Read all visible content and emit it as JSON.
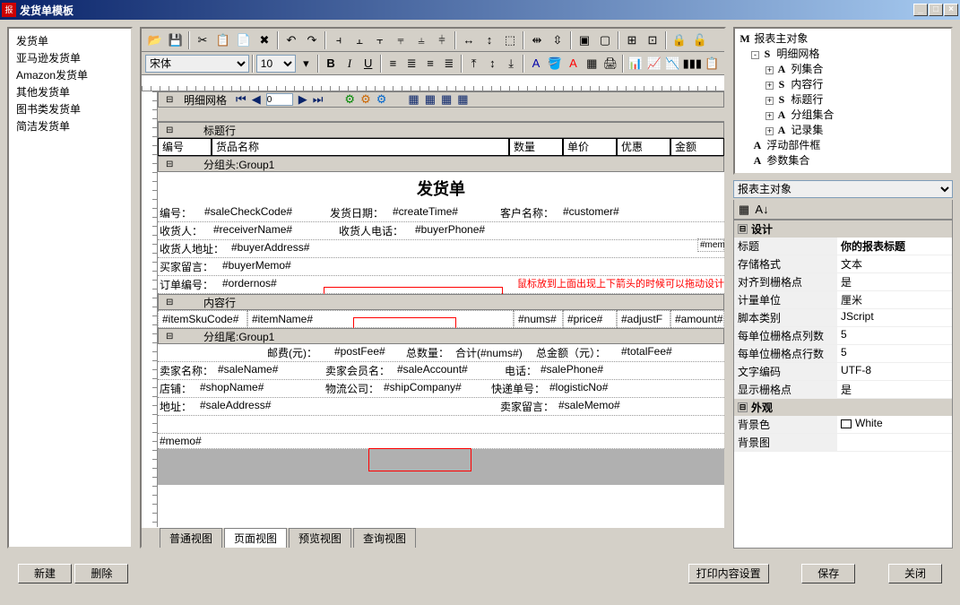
{
  "title": "发货单模板",
  "left_templates": [
    "发货单",
    "亚马逊发货单",
    "Amazon发货单",
    "其他发货单",
    "图书类发货单",
    "简洁发货单"
  ],
  "font": {
    "family": "宋体",
    "size": "10"
  },
  "grid_band": {
    "title": "明细网格",
    "page": "0"
  },
  "headers": {
    "c1": "编号",
    "c2": "货品名称",
    "c3": "数量",
    "c4": "单价",
    "c5": "优惠",
    "c6": "金额"
  },
  "bands": {
    "title_row": "标题行",
    "group_head": "分组头:Group1",
    "content_row": "内容行",
    "group_tail": "分组尾:Group1"
  },
  "report_title": "发货单",
  "fields": {
    "code_label": "编号：",
    "code_val": "#saleCheckCode#",
    "date_label": "发货日期：",
    "date_val": "#createTime#",
    "cust_label": "客户名称：",
    "cust_val": "#customer#",
    "recv_label": "收货人：",
    "recv_val": "#receiverName#",
    "phone_label": "收货人电话：",
    "phone_val": "#buyerPhone#",
    "addr_label": "收货人地址：",
    "addr_val": "#buyerAddress#",
    "memo_label": "买家留言：",
    "memo_val": "#buyerMemo#",
    "order_label": "订单编号：",
    "order_val": "#ordernos#",
    "side_memo": "#memo#oB",
    "sku": "#itemSkuCode#",
    "itemname": "#itemName#",
    "nums": "#nums#",
    "price": "#price#",
    "adjust": "#adjustF",
    "amount": "#amount#",
    "postfee_label": "邮费(元)：",
    "postfee": "#postFee#",
    "total_qty_label": "总数量：",
    "total_qty": "合计(#nums#)",
    "total_amt_label": "总金额（元）：",
    "total_amt": "#totalFee#",
    "seller_label": "卖家名称：",
    "seller": "#saleName#",
    "account_label": "卖家会员名：",
    "account": "#saleAccount#",
    "tel_label": "电话：",
    "tel": "#salePhone#",
    "shop_label": "店铺：",
    "shop": "#shopName#",
    "ship_label": "物流公司：",
    "ship": "#shipCompany#",
    "express_label": "快递单号：",
    "express": "#logisticNo#",
    "saddr_label": "地址：",
    "saddr": "#saleAddress#",
    "smemo_label": "卖家留言：",
    "smemo": "#saleMemo#",
    "bottom_memo": "#memo#"
  },
  "hint": "鼠标放到上面出现上下箭头的时候可以拖动设计",
  "tree": {
    "root": "报表主对象",
    "nodes": [
      "明细网格",
      "列集合",
      "内容行",
      "标题行",
      "分组集合",
      "记录集",
      "浮动部件框",
      "参数集合"
    ]
  },
  "prop_combo": "报表主对象",
  "prop_sections": {
    "design": "设计",
    "appearance": "外观"
  },
  "props": {
    "title_k": "标题",
    "title_v": "你的报表标题",
    "format_k": "存储格式",
    "format_v": "文本",
    "align_k": "对齐到栅格点",
    "align_v": "是",
    "unit_k": "计量单位",
    "unit_v": "厘米",
    "script_k": "脚本类别",
    "script_v": "JScript",
    "cols_k": "每单位栅格点列数",
    "cols_v": "5",
    "rows_k": "每单位栅格点行数",
    "rows_v": "5",
    "enc_k": "文字编码",
    "enc_v": "UTF-8",
    "grid_k": "显示栅格点",
    "grid_v": "是",
    "bg_k": "背景色",
    "bg_v": "White",
    "bgimg_k": "背景图",
    "bgimg_v": ""
  },
  "view_tabs": [
    "普通视图",
    "页面视图",
    "预览视图",
    "查询视图"
  ],
  "buttons": {
    "new": "新建",
    "delete": "删除",
    "print": "打印内容设置",
    "save": "保存",
    "close": "关闭"
  }
}
